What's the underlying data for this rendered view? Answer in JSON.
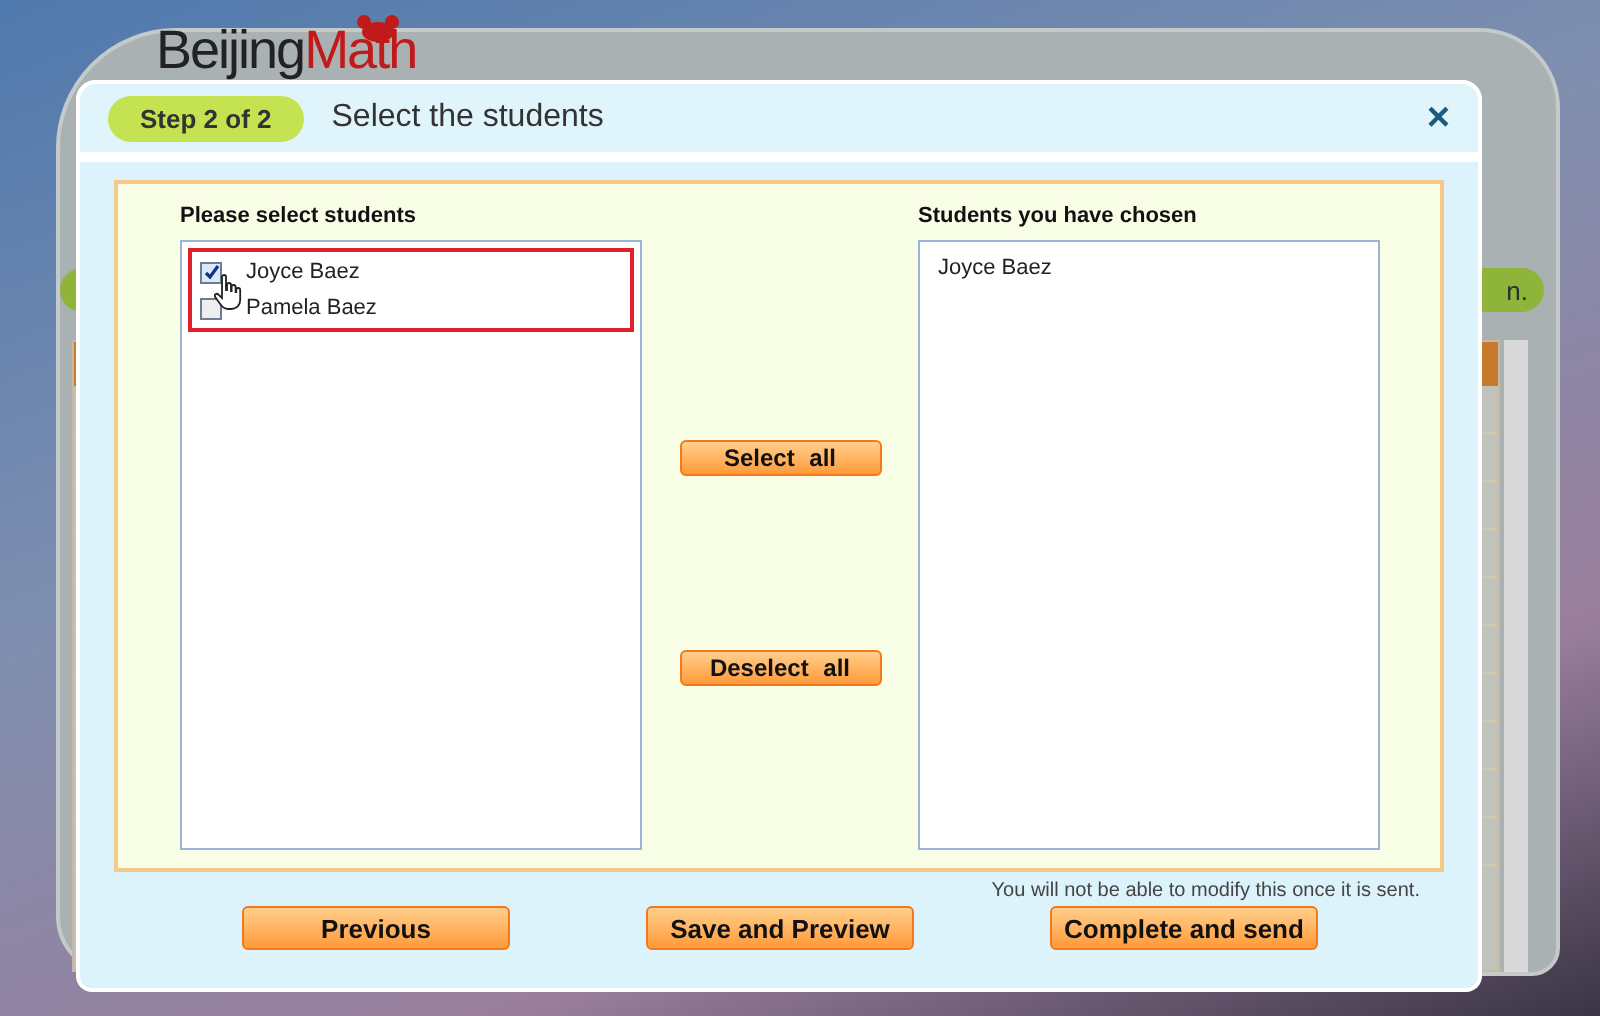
{
  "background": {
    "logo": {
      "first": "Beijing",
      "second": "Math"
    },
    "toolbar_button": "n."
  },
  "dialog": {
    "step": "Step 2 of 2",
    "title": "Select the students",
    "close": "×",
    "available": {
      "label": "Please select students",
      "students": [
        {
          "name": "Joyce Baez",
          "checked": true
        },
        {
          "name": "Pamela Baez",
          "checked": false
        }
      ]
    },
    "actions": [
      "Select all",
      "Deselect all"
    ],
    "chosen": {
      "label": "Students you have chosen",
      "students": [
        "Joyce Baez"
      ]
    },
    "note": "You will not be able to modify this once it is sent.",
    "buttons": [
      "Previous",
      "Save and Preview",
      "Complete and send"
    ]
  }
}
